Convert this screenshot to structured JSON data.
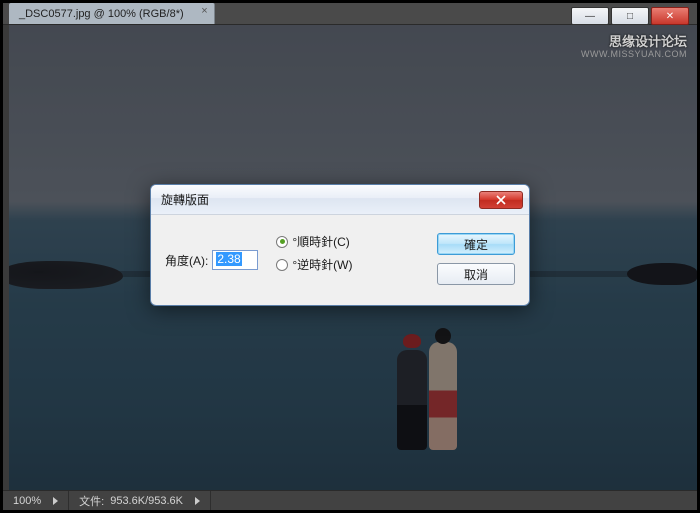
{
  "tab": {
    "title": "_DSC0577.jpg @ 100% (RGB/8*)"
  },
  "watermark": {
    "line1": "思缘设计论坛",
    "line2": "WWW.MISSYUAN.COM"
  },
  "statusbar": {
    "zoom": "100%",
    "filesize_label": "文件:",
    "filesize": "953.6K/953.6K"
  },
  "dialog": {
    "title": "旋轉版面",
    "angle_label": "角度(A):",
    "angle_value": "2.38",
    "radio_cw": "°順時針(C)",
    "radio_ccw": "°逆時針(W)",
    "ok": "確定",
    "cancel": "取消"
  }
}
